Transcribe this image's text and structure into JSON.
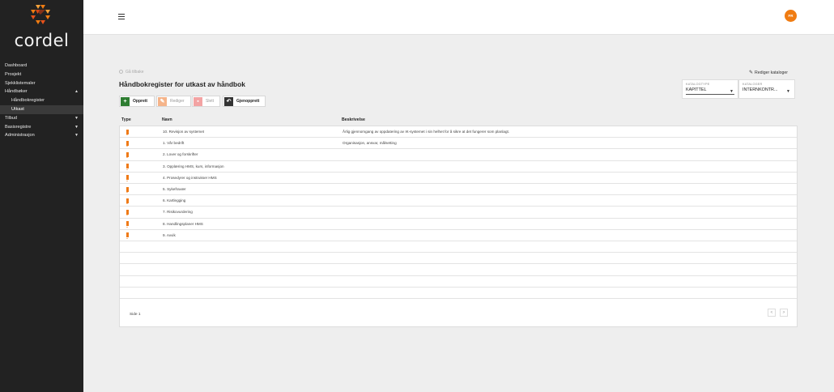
{
  "app": {
    "logo_text": "cordel",
    "user_initials": "FR",
    "accent_color": "#f07c12"
  },
  "sidebar": {
    "items": [
      {
        "label": "Dashboard",
        "sub": false,
        "active": false,
        "chevron": ""
      },
      {
        "label": "Prosjekt",
        "sub": false,
        "active": false,
        "chevron": ""
      },
      {
        "label": "Sjekklistemaler",
        "sub": false,
        "active": false,
        "chevron": ""
      },
      {
        "label": "Håndbøker",
        "sub": false,
        "active": false,
        "chevron": "▲"
      },
      {
        "label": "Håndbokregister",
        "sub": true,
        "active": false,
        "chevron": ""
      },
      {
        "label": "Utkast",
        "sub": true,
        "active": true,
        "chevron": ""
      },
      {
        "label": "Tilbud",
        "sub": false,
        "active": false,
        "chevron": "▼"
      },
      {
        "label": "Basisregistre",
        "sub": false,
        "active": false,
        "chevron": "▼"
      },
      {
        "label": "Administrasjon",
        "sub": false,
        "active": false,
        "chevron": "▼"
      }
    ]
  },
  "page": {
    "back_label": "Gå tilbake",
    "title": "Håndbokregister for utkast av håndbok",
    "edit_catalogs_label": "Rediger kataloger"
  },
  "filters": {
    "katalogtype": {
      "label": "KATALOGTYPE",
      "value": "KAPITTEL"
    },
    "kataloger": {
      "label": "KATALOGER",
      "value": "INTERNKONTR..."
    }
  },
  "toolbar": {
    "create_label": "Opprett",
    "edit_label": "Rediger",
    "delete_label": "Slett",
    "restore_label": "Gjenopprett"
  },
  "table": {
    "columns": {
      "type": "Type",
      "name": "Navn",
      "description": "Beskrivelse"
    },
    "rows": [
      {
        "name": "10. Revisjon av systemet",
        "description": "Årlig gjennomgang av oppdatering av IK-systemet i sin helhet for å sikre at det fungerer som planlagt."
      },
      {
        "name": "1. Vår bedrift",
        "description": "Organisasjon, ansvar, målsetting"
      },
      {
        "name": "2. Lover og forskrifter",
        "description": ""
      },
      {
        "name": "3. Opplæring HMS, kurs, informasjon",
        "description": ""
      },
      {
        "name": "4. Prosedyrer og instrukser HMS",
        "description": ""
      },
      {
        "name": "5. Sykefravær",
        "description": ""
      },
      {
        "name": "6. Kartlegging",
        "description": ""
      },
      {
        "name": "7. Risikovurdering",
        "description": ""
      },
      {
        "name": "8. Handlingsplaner HMS",
        "description": ""
      },
      {
        "name": "9. Avvik",
        "description": ""
      }
    ],
    "empty_rows": 5,
    "footer_label": "Side 1",
    "prev_label": "<",
    "next_label": ">"
  }
}
